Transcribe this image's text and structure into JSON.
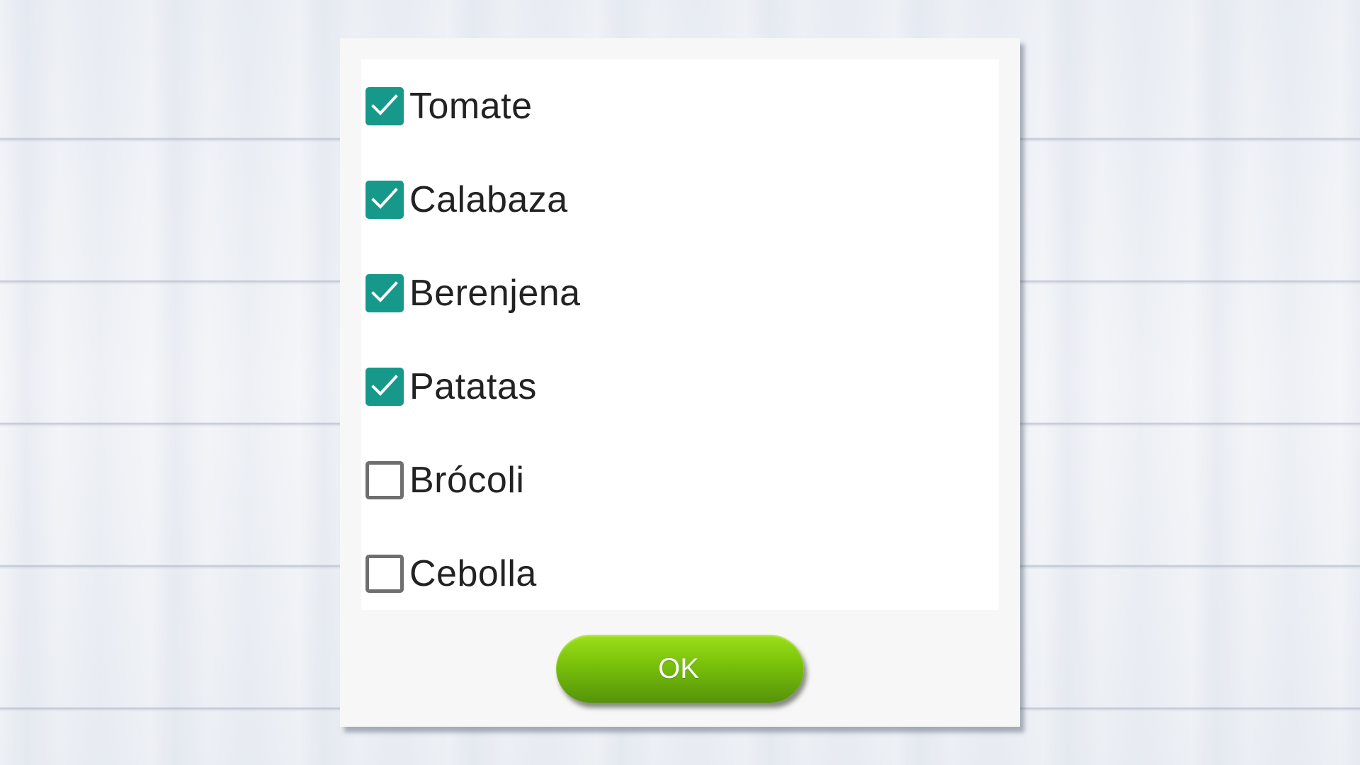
{
  "dialog": {
    "options": [
      {
        "label": "Tomate",
        "checked": true
      },
      {
        "label": "Calabaza",
        "checked": true
      },
      {
        "label": "Berenjena",
        "checked": true
      },
      {
        "label": "Patatas",
        "checked": true
      },
      {
        "label": "Brócoli",
        "checked": false
      },
      {
        "label": "Cebolla",
        "checked": false
      }
    ],
    "ok_label": "OK"
  },
  "colors": {
    "checkbox_checked": "#16998a",
    "checkbox_unchecked_border": "#6f6f6f",
    "ok_button_top": "#9de01a",
    "ok_button_bottom": "#56930a"
  },
  "icons": {
    "checked": "checkmark-icon"
  }
}
